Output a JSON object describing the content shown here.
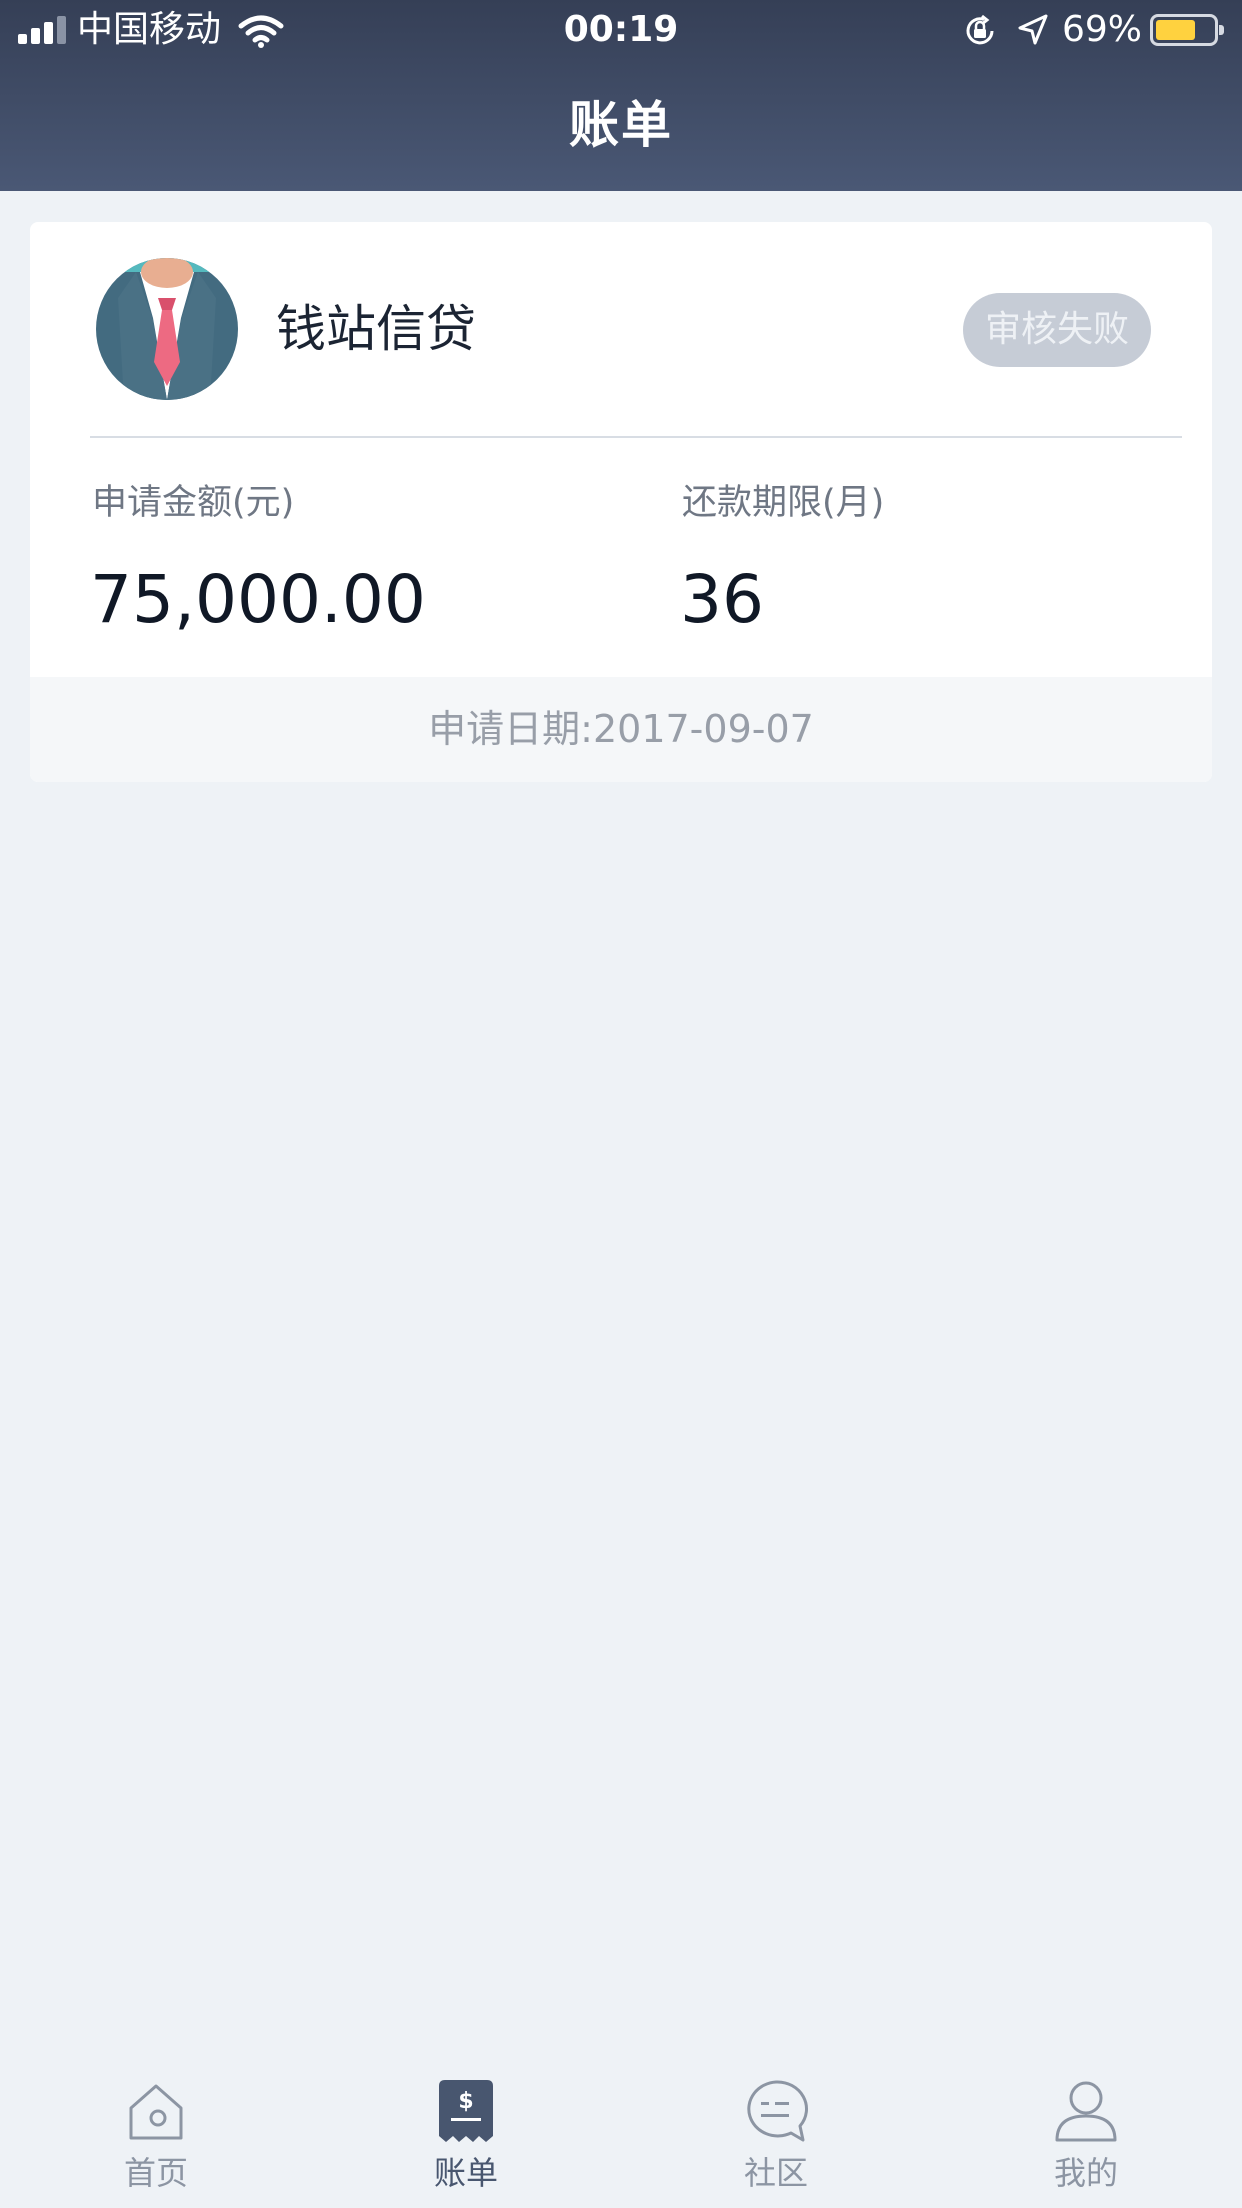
{
  "status_bar": {
    "carrier": "中国移动",
    "time": "00:19",
    "battery_percent": "69%",
    "battery_level": 0.69,
    "icons": [
      "signal-icon",
      "wifi-icon",
      "orientation-lock-icon",
      "location-icon",
      "battery-icon"
    ]
  },
  "header": {
    "title": "账单"
  },
  "loan_card": {
    "company": "钱站信贷",
    "status": "审核失败",
    "amount_label": "申请金额(元)",
    "amount_value": "75,000.00",
    "term_label": "还款期限(月)",
    "term_value": "36",
    "apply_date": "申请日期:2017-09-07"
  },
  "tabbar": {
    "tabs": [
      {
        "label": "首页",
        "icon": "home-icon",
        "active": false
      },
      {
        "label": "账单",
        "icon": "bill-icon",
        "active": true
      },
      {
        "label": "社区",
        "icon": "chat-icon",
        "active": false
      },
      {
        "label": "我的",
        "icon": "person-icon",
        "active": false
      }
    ]
  },
  "colors": {
    "header_top": "#353f56",
    "header_bottom": "#4a5875",
    "page_background": "#eef2f6",
    "status_badge": "#c6ccd6",
    "tab_active": "#48566f",
    "tab_inactive": "#8c95a3"
  }
}
